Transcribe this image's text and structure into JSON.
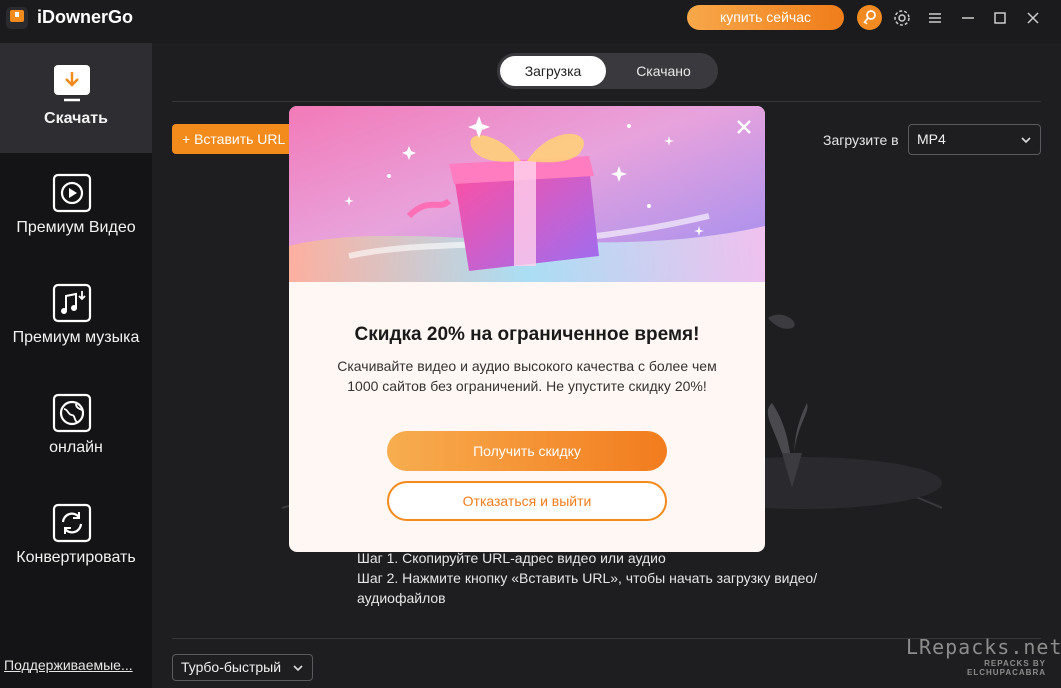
{
  "app": {
    "title": "iDownerGo"
  },
  "titlebar": {
    "buy_label": "купить сейчас"
  },
  "sidebar": {
    "items": [
      {
        "label": "Скачать",
        "icon": "download-icon"
      },
      {
        "label": "Премиум Видео",
        "icon": "play-video-icon"
      },
      {
        "label": "Премиум музыка",
        "icon": "music-icon"
      },
      {
        "label": "онлайн",
        "icon": "globe-icon"
      },
      {
        "label": "Конвертировать",
        "icon": "convert-icon"
      }
    ],
    "supported_link": "Поддерживаемые..."
  },
  "main": {
    "tabs": [
      {
        "label": "Загрузка"
      },
      {
        "label": "Скачано"
      }
    ],
    "paste_label": "+ Вставить URL",
    "format_label": "Загрузите в",
    "format_value": "MP4",
    "steps": [
      "Шаг 1. Скопируйте URL-адрес видео или аудио",
      "Шаг 2. Нажмите кнопку «Вставить URL», чтобы начать загрузку видео/ аудиофайлов"
    ],
    "speed_value": "Турбо-быстрый"
  },
  "modal": {
    "title": "Скидка 20% на ограниченное время!",
    "body": "Скачивайте видео и аудио высокого качества с более чем 1000 сайтов без ограничений. Не упустите скидку 20%!",
    "primary_label": "Получить скидку",
    "secondary_label": "Отказаться и выйти"
  },
  "watermark": {
    "main": "LRepacks.net",
    "sub": "REPACKS BY ELCHUPACABRA"
  },
  "colors": {
    "accent": "#f28a1c",
    "sidebar_bg": "#141416",
    "main_bg": "#1e1e21",
    "modal_bg": "#fff7f3"
  }
}
